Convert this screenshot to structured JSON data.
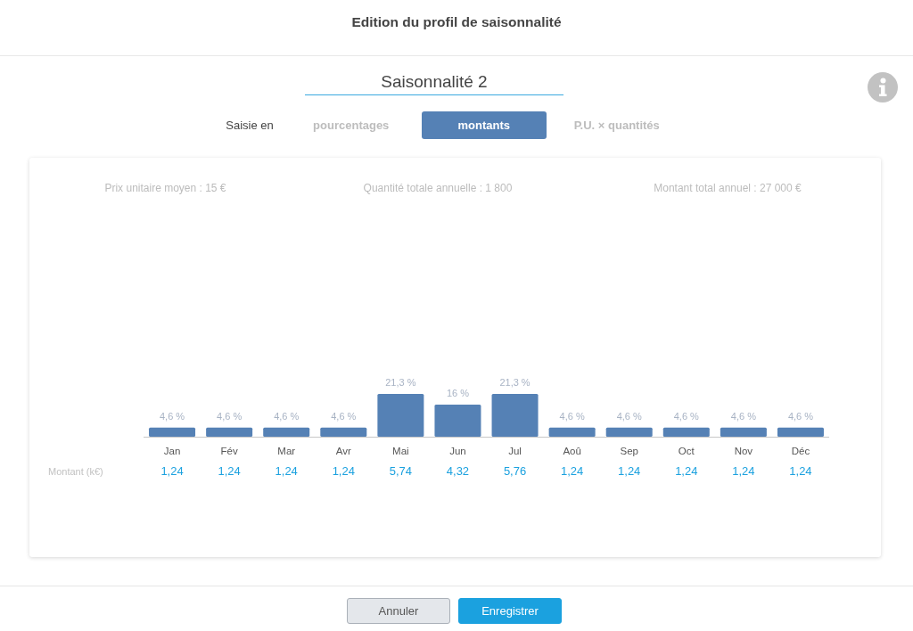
{
  "dialog": {
    "title": "Edition du profil de saisonnalité"
  },
  "profile_name": {
    "value": "Saisonnalité 2"
  },
  "input_mode": {
    "label": "Saisie en",
    "options": [
      {
        "label": "pourcentages",
        "selected": false
      },
      {
        "label": "montants",
        "selected": true
      },
      {
        "label": "P.U. × quantités",
        "selected": false
      }
    ]
  },
  "summary": [
    "Prix unitaire moyen : 15 €",
    "Quantité totale annuelle : 1 800",
    "Montant total annuel : 27 000 €"
  ],
  "chart": {
    "chart_data": {
      "type": "bar",
      "categories": [
        "Jan",
        "Fév",
        "Mar",
        "Avr",
        "Mai",
        "Jun",
        "Jul",
        "Aoû",
        "Sep",
        "Oct",
        "Nov",
        "Déc"
      ],
      "values": [
        4.6,
        4.6,
        4.6,
        4.6,
        21.3,
        16,
        21.3,
        4.6,
        4.6,
        4.6,
        4.6,
        4.6
      ],
      "value_labels": [
        "4,6 %",
        "4,6 %",
        "4,6 %",
        "4,6 %",
        "21,3 %",
        "16 %",
        "21,3 %",
        "4,6 %",
        "4,6 %",
        "4,6 %",
        "4,6 %",
        "4,6 %"
      ]
    }
  },
  "amounts": {
    "label": "Montant (k€)",
    "values": [
      "1,24",
      "1,24",
      "1,24",
      "1,24",
      "5,74",
      "4,32",
      "5,76",
      "1,24",
      "1,24",
      "1,24",
      "1,24",
      "1,24"
    ]
  },
  "buttons": [
    {
      "label": "Annuler",
      "kind": "secondary"
    },
    {
      "label": "Enregistrer",
      "kind": "primary"
    }
  ]
}
